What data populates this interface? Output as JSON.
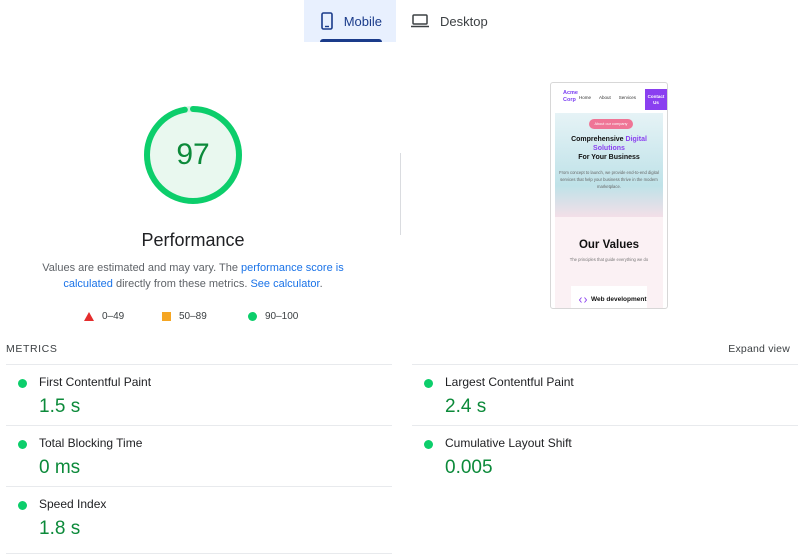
{
  "tabs": [
    {
      "label": "Mobile",
      "icon": "smartphone-icon",
      "active": true
    },
    {
      "label": "Desktop",
      "icon": "laptop-icon",
      "active": false
    }
  ],
  "score": {
    "value": "97",
    "fraction": 0.97,
    "category": "Performance",
    "color": "#0cce6b"
  },
  "description": {
    "prefix": "Values are estimated and may vary. The ",
    "link1": "performance score is calculated",
    "middle": " directly from these metrics. ",
    "link2": "See calculator",
    "suffix": "."
  },
  "legend": [
    {
      "range": "0–49",
      "shape": "triangle",
      "color": "#e42d2d"
    },
    {
      "range": "50–89",
      "shape": "square",
      "color": "#f5a623"
    },
    {
      "range": "90–100",
      "shape": "circle",
      "color": "#0cce6b"
    }
  ],
  "preview": {
    "brand": "Acme Corp",
    "nav": [
      "Home",
      "About",
      "Services"
    ],
    "contact": "Contact Us",
    "badge": "About our company",
    "heading_pre": "Comprehensive ",
    "heading_hl": "Digital Solutions",
    "heading_post": "For Your Business",
    "body": "From concept to launch, we provide end-to-end digital services that help your business thrive in the modern marketplace.",
    "values_title": "Our Values",
    "values_sub": "The principles that guide everything we do",
    "card": "Web development"
  },
  "metrics_header": {
    "label": "METRICS",
    "expand": "Expand view"
  },
  "metrics": [
    {
      "name": "First Contentful Paint",
      "value": "1.5 s"
    },
    {
      "name": "Largest Contentful Paint",
      "value": "2.4 s"
    },
    {
      "name": "Total Blocking Time",
      "value": "0 ms"
    },
    {
      "name": "Cumulative Layout Shift",
      "value": "0.005"
    },
    {
      "name": "Speed Index",
      "value": "1.8 s"
    }
  ]
}
